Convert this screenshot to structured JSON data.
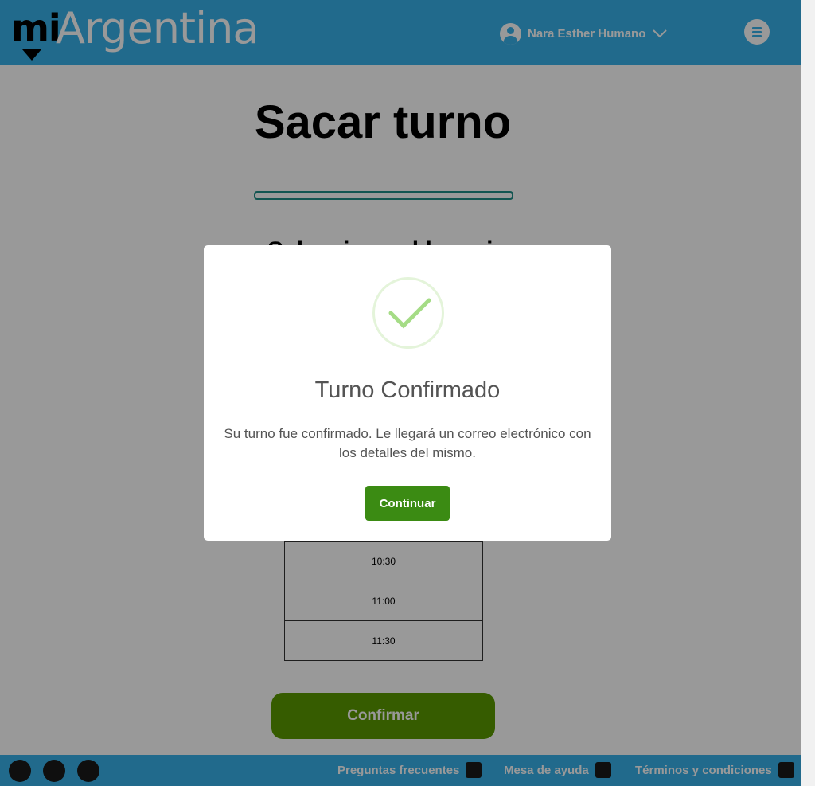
{
  "header": {
    "logo_mi": "mi",
    "logo_argentina": "Argentina",
    "user_name": "Nara Esther Humano"
  },
  "main": {
    "title": "Sacar turno",
    "subtitle": "Seleccione el horario",
    "time_slots": [
      "10:30",
      "11:00",
      "11:30"
    ],
    "confirm_label": "Confirmar"
  },
  "footer": {
    "faq": "Preguntas frecuentes",
    "help": "Mesa de ayuda",
    "terms": "Términos y condiciones"
  },
  "modal": {
    "title": "Turno Confirmado",
    "message": "Su turno fue confirmado. Le llegará un correo electrónico con los detalles del mismo.",
    "button_label": "Continuar"
  },
  "colors": {
    "header": "#37b1ea",
    "success_check": "#a5dc86",
    "modal_button": "#3b8b13"
  }
}
